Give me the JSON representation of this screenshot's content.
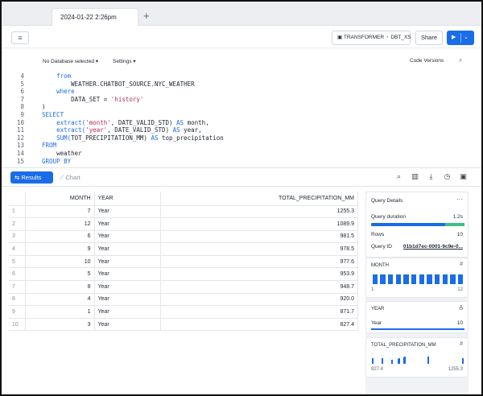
{
  "tab": {
    "title": "2024-01-22 2:26pm",
    "add": "+"
  },
  "toolbar": {
    "context_role": "TRANSFORMER",
    "context_warehouse": "DBT_XS",
    "share_label": "Share"
  },
  "editor": {
    "database_label": "No Database selected",
    "settings_label": "Settings",
    "code_versions_label": "Code Versions"
  },
  "code_lines": [
    {
      "n": "4",
      "indent": "    ",
      "parts": [
        {
          "t": "from",
          "c": "kw"
        }
      ]
    },
    {
      "n": "5",
      "indent": "        ",
      "parts": [
        {
          "t": "WEATHER.CHATBOT_SOURCE.NYC_WEATHER",
          "c": "plain"
        }
      ]
    },
    {
      "n": "6",
      "indent": "    ",
      "parts": [
        {
          "t": "where",
          "c": "kw"
        }
      ]
    },
    {
      "n": "7",
      "indent": "        ",
      "parts": [
        {
          "t": "DATA_SET = ",
          "c": "plain"
        },
        {
          "t": "'history'",
          "c": "str"
        }
      ]
    },
    {
      "n": "8",
      "indent": "",
      "parts": [
        {
          "t": ")",
          "c": "plain"
        }
      ]
    },
    {
      "n": "9",
      "indent": "",
      "parts": [
        {
          "t": "SELECT",
          "c": "kw"
        }
      ]
    },
    {
      "n": "10",
      "indent": "    ",
      "parts": [
        {
          "t": "extract(",
          "c": "kw"
        },
        {
          "t": "'month'",
          "c": "str"
        },
        {
          "t": ", DATE_VALID_STD) ",
          "c": "plain"
        },
        {
          "t": "AS",
          "c": "kw"
        },
        {
          "t": " month,",
          "c": "plain"
        }
      ]
    },
    {
      "n": "11",
      "indent": "    ",
      "parts": [
        {
          "t": "extract(",
          "c": "kw"
        },
        {
          "t": "'year'",
          "c": "str"
        },
        {
          "t": ", DATE_VALID_STD) ",
          "c": "plain"
        },
        {
          "t": "AS",
          "c": "kw"
        },
        {
          "t": " year,",
          "c": "plain"
        }
      ]
    },
    {
      "n": "12",
      "indent": "    ",
      "parts": [
        {
          "t": "SUM(",
          "c": "kw"
        },
        {
          "t": "TOT_PRECIPITATION_MM) ",
          "c": "plain"
        },
        {
          "t": "AS",
          "c": "kw"
        },
        {
          "t": " top_precipitation",
          "c": "plain"
        }
      ]
    },
    {
      "n": "13",
      "indent": "",
      "parts": [
        {
          "t": "FROM",
          "c": "kw"
        }
      ]
    },
    {
      "n": "14",
      "indent": "    ",
      "parts": [
        {
          "t": "weather",
          "c": "plain"
        }
      ]
    },
    {
      "n": "15",
      "indent": "",
      "parts": [
        {
          "t": "GROUP BY",
          "c": "kw"
        }
      ]
    }
  ],
  "results": {
    "results_tab": "Results",
    "chart_tab": "Chart",
    "columns": [
      "MONTH",
      "YEAR",
      "TOTAL_PRECIPITATION_MM"
    ],
    "rows": [
      [
        "1",
        "7",
        "Year",
        "1255.3"
      ],
      [
        "2",
        "12",
        "Year",
        "1089.9"
      ],
      [
        "3",
        "6",
        "Year",
        "981.5"
      ],
      [
        "4",
        "9",
        "Year",
        "978.5"
      ],
      [
        "5",
        "10",
        "Year",
        "977.6"
      ],
      [
        "6",
        "5",
        "Year",
        "953.9"
      ],
      [
        "7",
        "8",
        "Year",
        "948.7"
      ],
      [
        "8",
        "4",
        "Year",
        "920.0"
      ],
      [
        "9",
        "1",
        "Year",
        "871.7"
      ],
      [
        "10",
        "3",
        "Year",
        "827.4"
      ]
    ]
  },
  "query_details": {
    "title": "Query Details",
    "duration_label": "Query duration",
    "duration_value": "1.2s",
    "rows_label": "Rows",
    "rows_value": "10",
    "query_id_label": "Query ID",
    "query_id_value": "01b1d7ec-0001-9c9e-0..."
  },
  "column_stats": {
    "month": {
      "title": "MONTH",
      "min": "1",
      "max": "12",
      "bars": [
        1,
        1,
        1,
        1,
        1,
        1,
        1,
        1,
        1,
        1,
        1,
        1
      ]
    },
    "year": {
      "title": "YEAR",
      "value": "Year",
      "count": "10"
    },
    "precip": {
      "title": "TOTAL_PRECIPITATION_MM",
      "min": "827.4",
      "max": "1255.3"
    }
  },
  "colors": {
    "accent": "#1a6ce7",
    "success": "#3fbf86"
  }
}
